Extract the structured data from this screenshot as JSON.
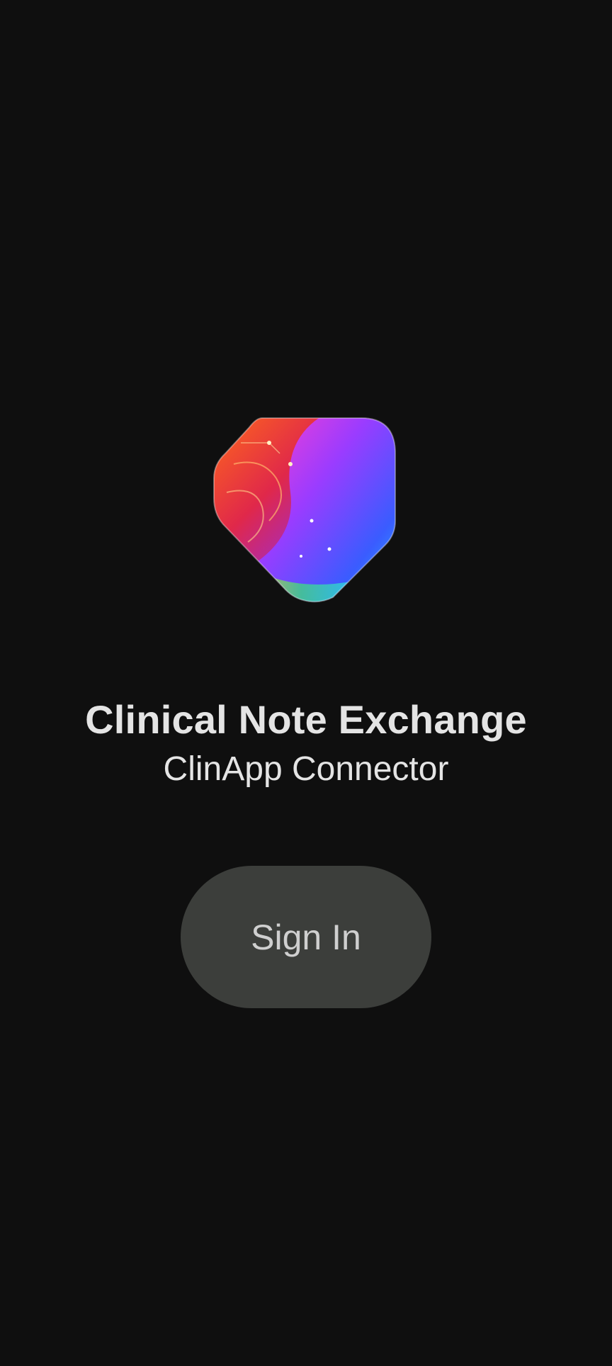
{
  "app": {
    "title": "Clinical Note Exchange",
    "subtitle": "ClinApp Connector",
    "logo_icon": "app-logo-icon"
  },
  "actions": {
    "sign_in_label": "Sign In"
  },
  "colors": {
    "background": "#0f0f0f",
    "text": "#e4e4e4",
    "button_background": "#3c3e3b",
    "button_text": "#cfcfcf"
  }
}
